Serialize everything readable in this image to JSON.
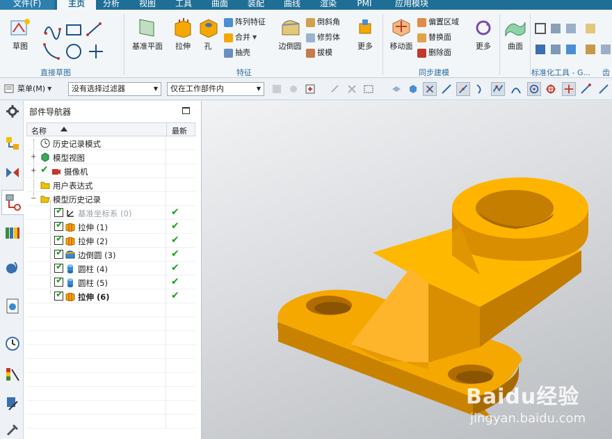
{
  "tabs": [
    {
      "label": "文件(F)",
      "active": false
    },
    {
      "label": "主页",
      "active": true
    },
    {
      "label": "分析",
      "active": false
    },
    {
      "label": "视图",
      "active": false
    },
    {
      "label": "工具",
      "active": false
    },
    {
      "label": "曲面",
      "active": false
    },
    {
      "label": "装配",
      "active": false
    },
    {
      "label": "曲线",
      "active": false
    },
    {
      "label": "渲染",
      "active": false
    },
    {
      "label": "PMI",
      "active": false
    },
    {
      "label": "应用模块",
      "active": false
    }
  ],
  "ribbon": {
    "sketch": "草图",
    "direct_sketch_group": "直接草图",
    "datum_plane": "基准平面",
    "extrude": "拉伸",
    "hole": "孔",
    "pattern_feature": "阵列特征",
    "unite": "合并",
    "shell": "抽壳",
    "edge_blend": "边倒圆",
    "chamfer": "倒斜角",
    "trim_body": "修剪体",
    "draft": "拔模",
    "more_feature": "更多",
    "feature_group": "特征",
    "move_face": "移动面",
    "offset_region": "偏置区域",
    "replace_face": "替换面",
    "delete_face": "删除面",
    "more_sync": "更多",
    "sync_group": "同步建模",
    "surface": "曲面",
    "standard_tools_group": "标准化工具 - G...",
    "edge_group": "齿"
  },
  "toolbar": {
    "menu_label": "菜单(M)",
    "filter_value": "没有选择过滤器",
    "scope_value": "仅在工作部件内"
  },
  "navigator": {
    "title": "部件导航器",
    "col_name": "名称",
    "col_latest": "最新",
    "rows": [
      {
        "label": "历史记录模式"
      },
      {
        "label": "模型视图"
      },
      {
        "label": "摄像机"
      },
      {
        "label": "用户表达式"
      },
      {
        "label": "模型历史记录"
      },
      {
        "label": "基准坐标系 (0)"
      },
      {
        "label": "拉伸 (1)"
      },
      {
        "label": "拉伸 (2)"
      },
      {
        "label": "边倒圆 (3)"
      },
      {
        "label": "圆柱 (4)"
      },
      {
        "label": "圆柱 (5)"
      },
      {
        "label": "拉伸 (6)"
      }
    ],
    "latest_mark": "✔"
  },
  "watermark": {
    "main": "Baidu经验",
    "sub": "jingyan.baidu.com"
  },
  "colors": {
    "tab_bar": "#1f6e96",
    "part_orange": "#f5a800",
    "check_green": "#1aa11a"
  }
}
